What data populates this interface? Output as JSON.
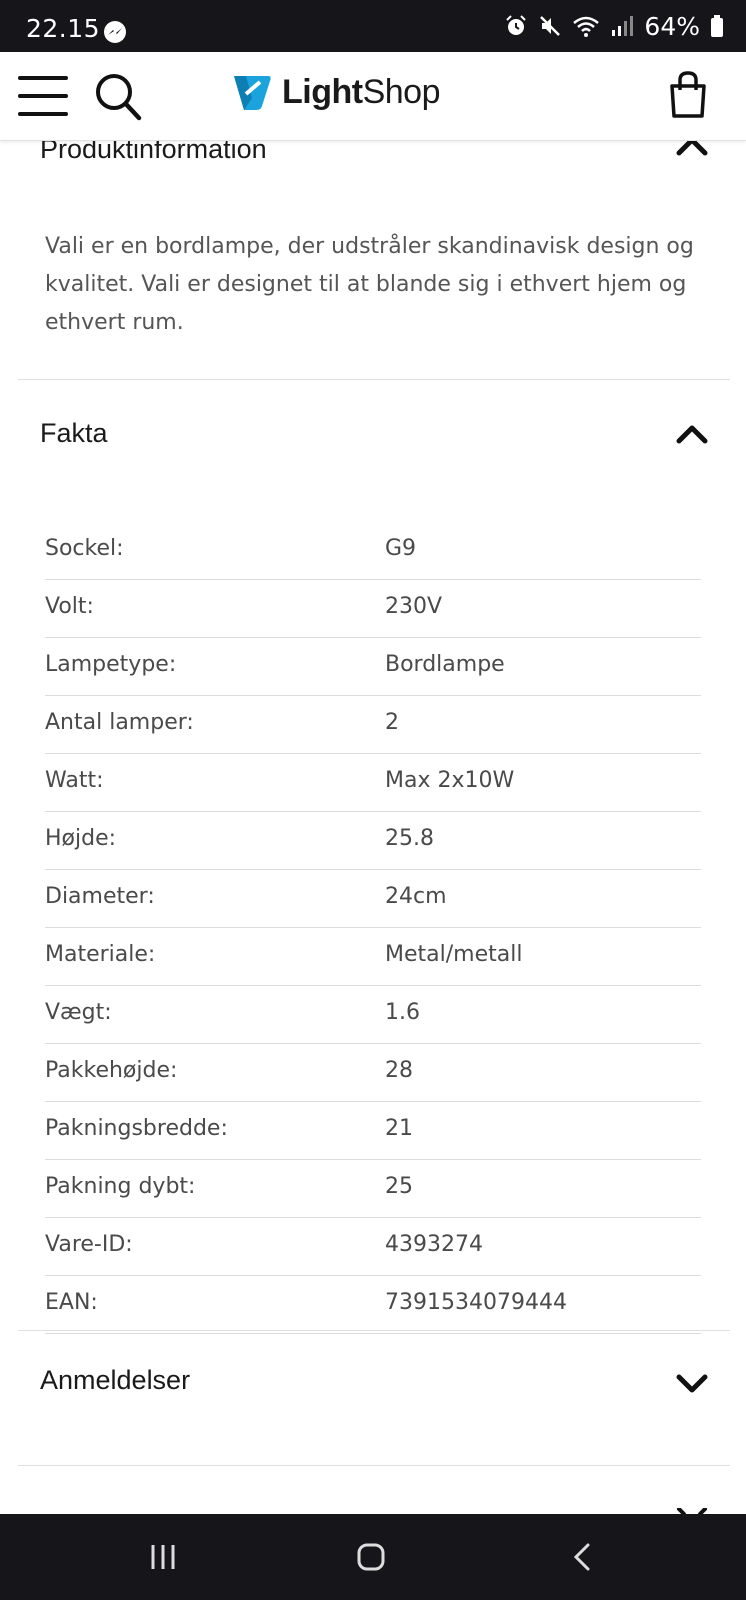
{
  "status_bar": {
    "time": "22.15",
    "battery": "64%"
  },
  "header": {
    "logo_bold": "Light",
    "logo_light": "Shop"
  },
  "product_info": {
    "title": "Produktinformation",
    "description": "Vali er en bordlampe, der udstråler skandinavisk design og kvalitet. Vali er designet til at blande sig i ethvert hjem og ethvert rum."
  },
  "facts": {
    "title": "Fakta",
    "rows": [
      {
        "label": "Sockel:",
        "value": "G9"
      },
      {
        "label": "Volt:",
        "value": "230V"
      },
      {
        "label": "Lampetype:",
        "value": "Bordlampe"
      },
      {
        "label": "Antal lamper:",
        "value": "2"
      },
      {
        "label": "Watt:",
        "value": "Max 2x10W"
      },
      {
        "label": "Højde:",
        "value": "25.8"
      },
      {
        "label": "Diameter:",
        "value": "24cm"
      },
      {
        "label": "Materiale:",
        "value": "Metal/metall"
      },
      {
        "label": "Vægt:",
        "value": "1.6"
      },
      {
        "label": "Pakkehøjde:",
        "value": "28"
      },
      {
        "label": "Pakningsbredde:",
        "value": "21"
      },
      {
        "label": "Pakning dybt:",
        "value": "25"
      },
      {
        "label": "Vare-ID:",
        "value": "4393274"
      },
      {
        "label": "EAN:",
        "value": "7391534079444"
      }
    ]
  },
  "reviews": {
    "title": "Anmeldelser"
  },
  "icons": {
    "menu": "hamburger-menu-icon",
    "search": "search-icon",
    "cart": "shopping-bag-icon",
    "collapse": "chevron-up-icon",
    "expand": "chevron-down-icon"
  },
  "colors": {
    "logo_blue": "#1aa3dd",
    "system_bars": "#16161a",
    "body_text": "#555555"
  }
}
